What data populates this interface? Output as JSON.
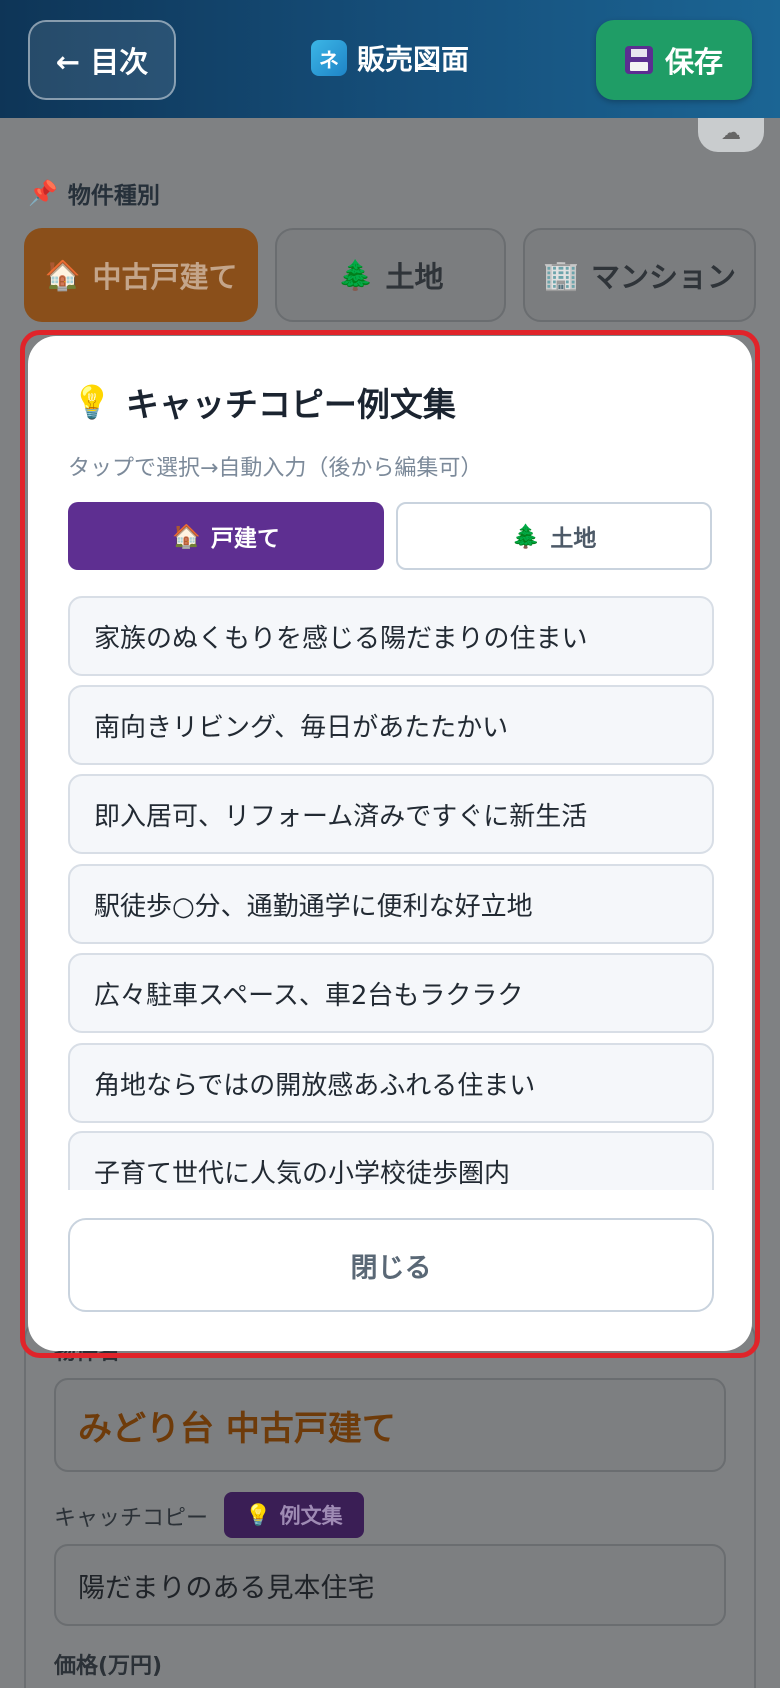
{
  "header": {
    "back_label": "← 目次",
    "title": "販売図面",
    "app_icon_glyph": "ネ",
    "save_label": "保存"
  },
  "background": {
    "section_label": "物件種別",
    "property_types": [
      {
        "label": "中古戸建て",
        "icon": "house-icon",
        "active": true
      },
      {
        "label": "土地",
        "icon": "tree-icon",
        "active": false
      },
      {
        "label": "マンション",
        "icon": "building-icon",
        "active": false
      }
    ],
    "name_label": "物件名",
    "name_value": "みどり台 中古戸建て",
    "catch_label": "キャッチコピー",
    "example_button": "例文集",
    "catch_value": "陽だまりのある見本住宅",
    "price_label": "価格(万円)",
    "cloud_icon": "cloud-icon"
  },
  "modal": {
    "title": "キャッチコピー例文集",
    "subtitle": "タップで選択→自動入力（後から編集可）",
    "tabs": [
      {
        "label": "戸建て",
        "icon": "house-icon",
        "active": true
      },
      {
        "label": "土地",
        "icon": "tree-icon",
        "active": false
      }
    ],
    "examples": [
      "家族のぬくもりを感じる陽だまりの住まい",
      "南向きリビング、毎日があたたかい",
      "即入居可、リフォーム済みですぐに新生活",
      "駅徒歩○分、通勤通学に便利な好立地",
      "広々駐車スペース、車2台もラクラク",
      "角地ならではの開放感あふれる住まい",
      "子育て世代に人気の小学校徒歩圏内"
    ],
    "close_label": "閉じる"
  },
  "colors": {
    "header_start": "#0e3557",
    "save_green": "#1f9d66",
    "active_tab_purple": "#5e2f91",
    "highlight_red": "#e0242a",
    "active_type_orange": "#8a4f1a"
  }
}
